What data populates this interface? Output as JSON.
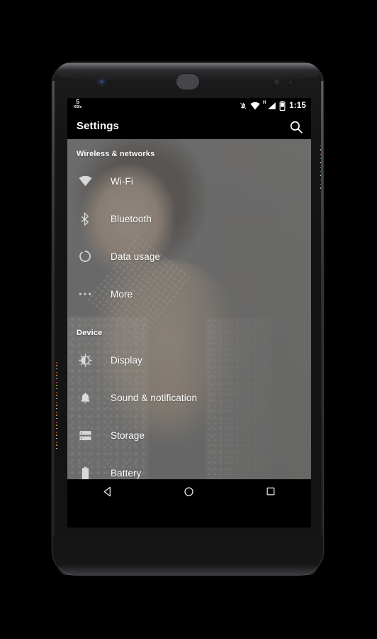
{
  "device": {
    "name": "android-phone-mockup",
    "camera_icon": "front-camera",
    "speaker_icon": "earpiece-speaker",
    "sensor_icon": "proximity-sensor"
  },
  "status_bar": {
    "network_speed_value": "5",
    "network_speed_unit": "KB/s",
    "clock": "1:15",
    "icons": [
      {
        "name": "ringer-muted-icon",
        "label": "Ringer muted"
      },
      {
        "name": "wifi-signal-icon",
        "label": "Wi-Fi signal"
      },
      {
        "name": "mobile-signal-icon",
        "label": "H mobile data",
        "network_type": "H"
      },
      {
        "name": "battery-icon",
        "label": "Battery"
      }
    ]
  },
  "action_bar": {
    "title": "Settings",
    "search_icon": "search-icon"
  },
  "sections": [
    {
      "header": "Wireless & networks",
      "items": [
        {
          "label": "Wi-Fi",
          "icon": "wifi-icon"
        },
        {
          "label": "Bluetooth",
          "icon": "bluetooth-icon"
        },
        {
          "label": "Data usage",
          "icon": "data-usage-icon"
        },
        {
          "label": "More",
          "icon": "more-icon"
        }
      ]
    },
    {
      "header": "Device",
      "items": [
        {
          "label": "Display",
          "icon": "display-icon"
        },
        {
          "label": "Sound & notification",
          "icon": "sound-icon"
        },
        {
          "label": "Storage",
          "icon": "storage-icon"
        },
        {
          "label": "Battery",
          "icon": "battery-icon"
        }
      ]
    }
  ],
  "nav_bar": {
    "back": "back-button",
    "home": "home-button",
    "recents": "recents-button"
  },
  "colors": {
    "page_background": "#000000",
    "action_bar": "#000000",
    "list_scrim": "#686868",
    "text_primary": "#ffffff",
    "nav_bar": "#000000"
  }
}
